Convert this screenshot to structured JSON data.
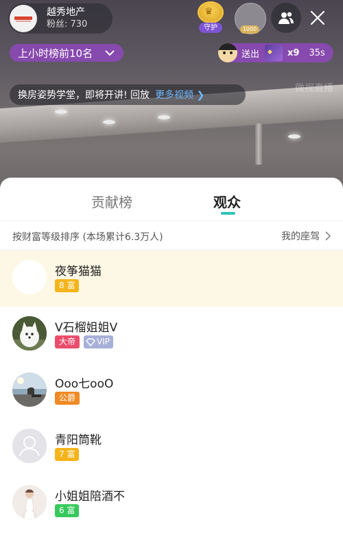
{
  "live": {
    "host": {
      "name": "越秀地产",
      "fans_label": "粉丝: 730"
    },
    "guard_label": "守护",
    "viewer_badge": "1000",
    "rank_label": "上小时榜前10名",
    "gift": {
      "send_label": "送出",
      "count": "x9",
      "timer": "35s"
    },
    "announcement": {
      "text": "换房姿势学堂，即将开讲! 回放",
      "more_link": "更多视频 ❯"
    },
    "watermark": "微视直播"
  },
  "sheet": {
    "tabs": [
      {
        "label": "贡献榜",
        "active": false
      },
      {
        "label": "观众",
        "active": true
      }
    ],
    "accent_color": "#2ec4b6",
    "sort_label": "按财富等级排序 (本场累计6.3万人)",
    "seat_link": "我的座驾",
    "audience": [
      {
        "name": "夜筝猫猫",
        "badges": [
          {
            "type": "wealth",
            "text": "8 富"
          }
        ],
        "avatar": "blank",
        "highlight": true
      },
      {
        "name": "V石榴姐姐V",
        "badges": [
          {
            "type": "emperor",
            "text": "大帝"
          },
          {
            "type": "vip",
            "text": "VIP"
          }
        ],
        "avatar": "white-dog"
      },
      {
        "name": "Ooo七ooO",
        "badges": [
          {
            "type": "duke",
            "text": "公爵"
          }
        ],
        "avatar": "seaside"
      },
      {
        "name": "青阳筒靴",
        "badges": [
          {
            "type": "wealth",
            "text": "7 富"
          }
        ],
        "avatar": "default-person"
      },
      {
        "name": "小姐姐陪酒不",
        "badges": [
          {
            "type": "green",
            "text": "6 富"
          }
        ],
        "avatar": "woman-white-dress"
      }
    ]
  }
}
